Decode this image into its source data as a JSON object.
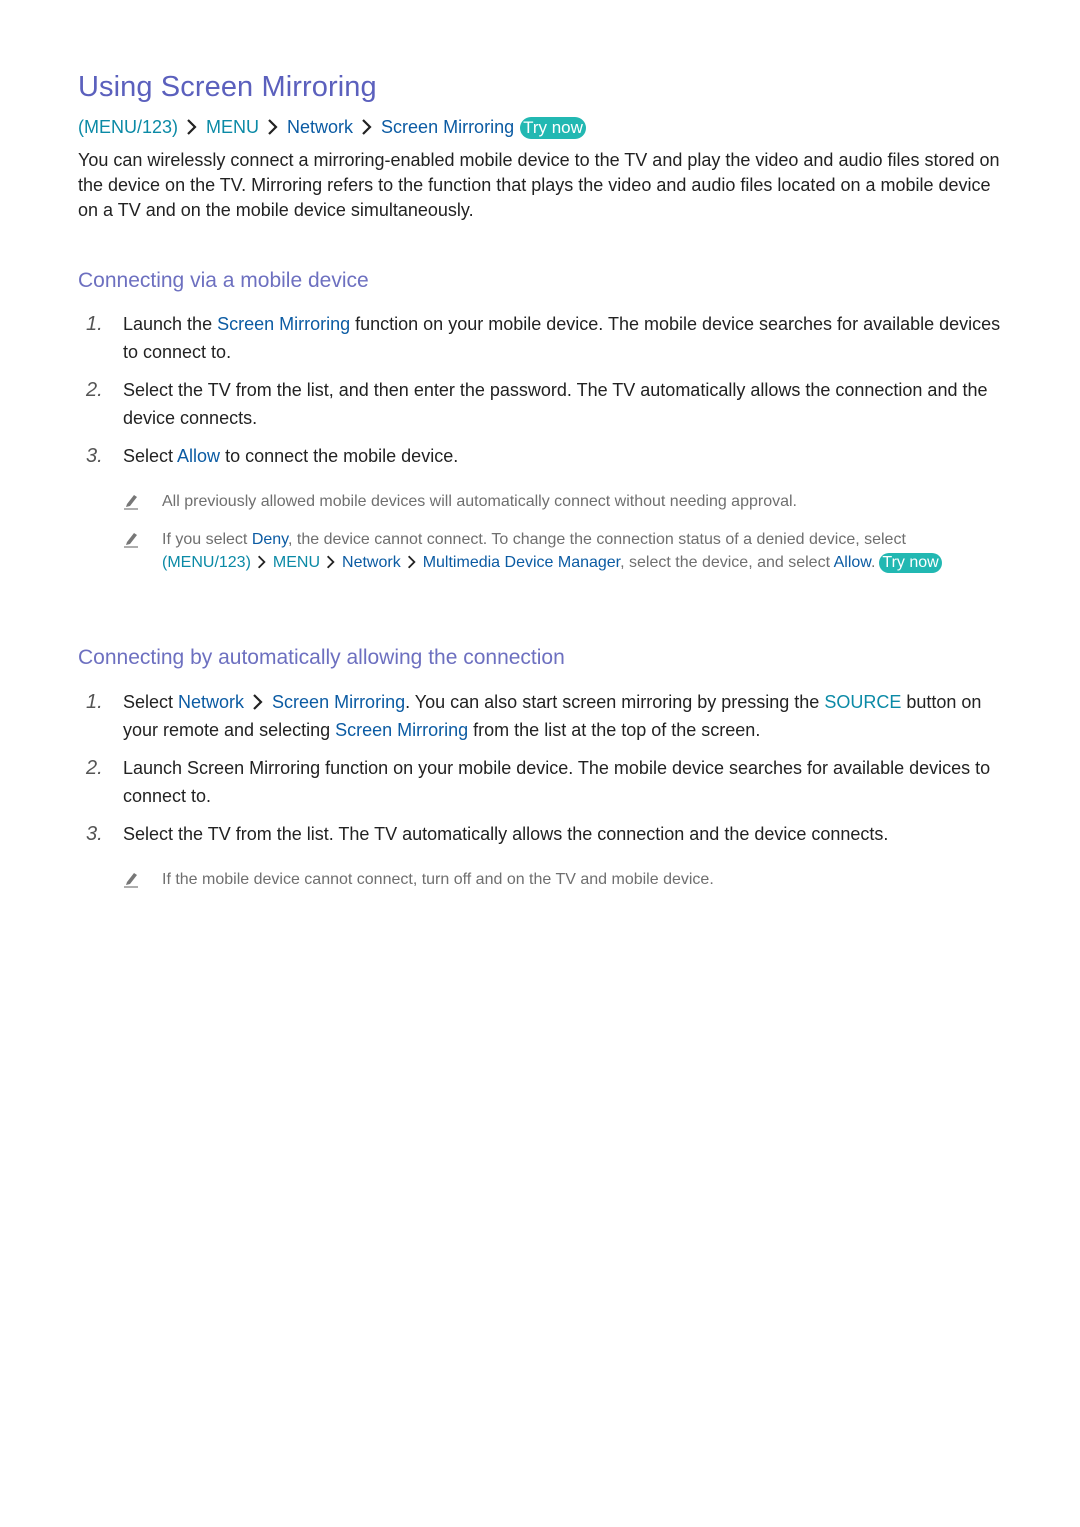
{
  "title": "Using Screen Mirroring",
  "breadcrumb": {
    "items": [
      "(MENU/123)",
      "MENU",
      "Network",
      "Screen Mirroring"
    ],
    "try_now": "Try now"
  },
  "intro": "You can wirelessly connect a mirroring-enabled mobile device to the TV and play the video and audio files stored on the device on the TV. Mirroring refers to the function that plays the video and audio files located on a mobile device on a TV and on the mobile device simultaneously.",
  "section1": {
    "heading": "Connecting via a mobile device",
    "steps": [
      {
        "num": "1.",
        "pre": "Launch the ",
        "link": "Screen Mirroring",
        "post": " function on your mobile device. The mobile device searches for available devices to connect to."
      },
      {
        "num": "2.",
        "text": "Select the TV from the list, and then enter the password. The TV automatically allows the connection and the device connects."
      },
      {
        "num": "3.",
        "pre": "Select ",
        "link": "Allow",
        "post": " to connect the mobile device."
      }
    ],
    "notes": [
      {
        "text": "All previously allowed mobile devices will automatically connect without needing approval."
      },
      {
        "pre": "If you select ",
        "deny": "Deny",
        "mid": ", the device cannot connect. To change the connection status of a denied device, select ",
        "path": [
          "(MENU/123)",
          "MENU",
          "Network",
          "Multimedia Device Manager"
        ],
        "post": ", select the device, and select ",
        "allow": "Allow",
        "end": ".",
        "try_now": "Try now"
      }
    ]
  },
  "section2": {
    "heading": "Connecting by automatically allowing the connection",
    "steps": [
      {
        "num": "1.",
        "pre": "Select ",
        "link1": "Network",
        "link2": "Screen Mirroring",
        "mid": ". You can also start screen mirroring by pressing the ",
        "source": "SOURCE",
        "mid2": " button on your remote and selecting ",
        "link3": "Screen Mirroring",
        "post": " from the list at the top of the screen."
      },
      {
        "num": "2.",
        "text": "Launch Screen Mirroring function on your mobile device. The mobile device searches for available devices to connect to."
      },
      {
        "num": "3.",
        "text": "Select the TV from the list. The TV automatically allows the connection and the device connects."
      }
    ],
    "notes": [
      {
        "text": "If the mobile device cannot connect, turn off and on the TV and mobile device."
      }
    ]
  },
  "colors": {
    "heading": "#5b60bd",
    "subheading": "#6d70c0",
    "menu_teal": "#0b8aa6",
    "link_blue": "#0b5ba3",
    "try_now_bg": "#22b8b2",
    "note_gray": "#6f6f6f"
  }
}
